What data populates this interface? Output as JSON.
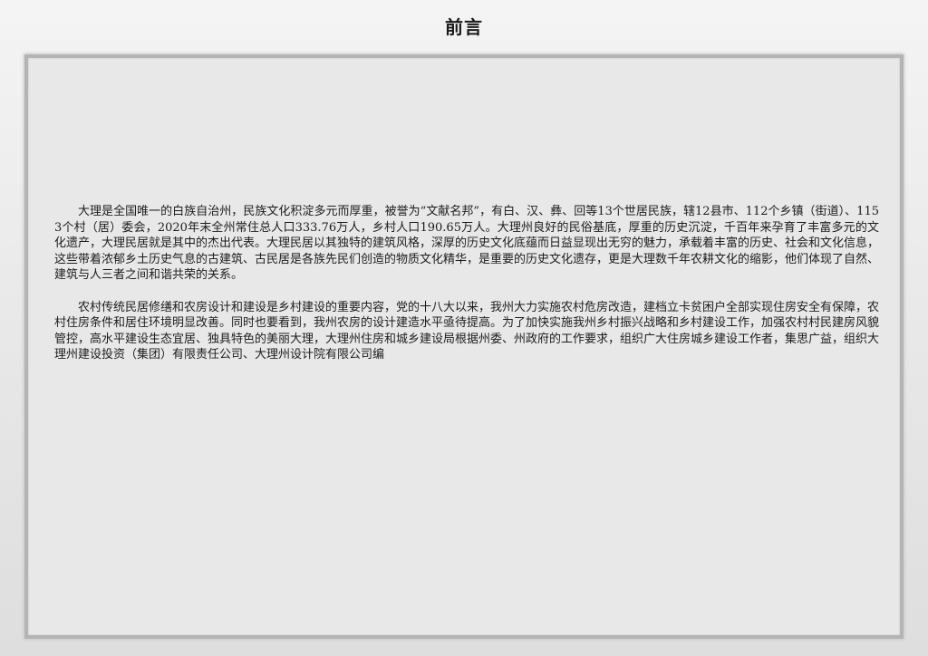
{
  "page": {
    "title": "前言"
  },
  "content": {
    "paragraphs": [
      "大理是全国唯一的白族自治州，民族文化积淀多元而厚重，被誉为“文献名邦”，有白、汉、彝、回等13个世居民族，辖12县市、112个乡镇（街道）、1153个村（居）委会，2020年末全州常住总人口333.76万人，乡村人口190.65万人。大理州良好的民俗基底，厚重的历史沉淀，千百年来孕育了丰富多元的文化遗产，大理民居就是其中的杰出代表。大理民居以其独特的建筑风格，深厚的历史文化底蕴而日益显现出无穷的魅力，承载着丰富的历史、社会和文化信息，这些带着浓郁乡土历史气息的古建筑、古民居是各族先民们创造的物质文化精华，是重要的历史文化遗存，更是大理数千年农耕文化的缩影，他们体现了自然、建筑与人三者之间和谐共荣的关系。",
      "农村传统民居修缮和农房设计和建设是乡村建设的重要内容，党的十八大以来，我州大力实施农村危房改造，建档立卡贫困户全部实现住房安全有保障，农村住房条件和居住环境明显改善。同时也要看到，我州农房的设计建造水平亟待提高。为了加快实施我州乡村振兴战略和乡村建设工作，加强农村村民建房风貌管控，高水平建设生态宜居、独具特色的美丽大理，大理州住房和城乡建设局根据州委、州政府的工作要求，组织广大住房城乡建设工作者，集思广益，组织大理州建设投资（集团）有限责任公司、大理州设计院有限公司编"
    ]
  }
}
